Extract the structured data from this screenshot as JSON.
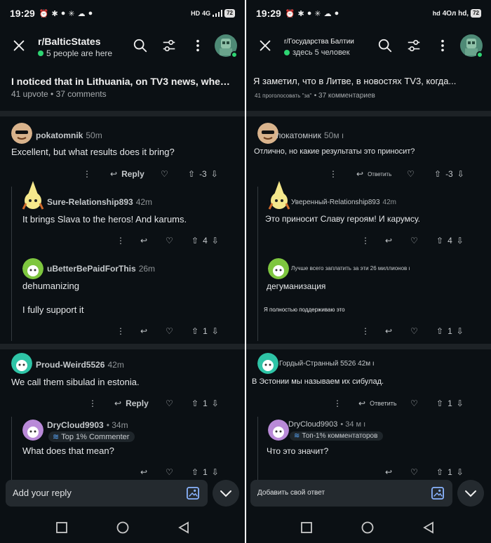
{
  "left": {
    "status": {
      "time": "19:29",
      "network": "HD",
      "network_type": "4G",
      "battery": "72"
    },
    "header": {
      "subreddit": "r/BalticStates",
      "online": "5 people are here"
    },
    "post": {
      "title": "I noticed that in Lithuania, on TV3 news, when the...",
      "meta": "41 upvote • 37 comments"
    },
    "comments": [
      {
        "author": "pokatomnik",
        "time": "50m",
        "body": "Excellent, but what results does it bring?",
        "reply_label": "Reply",
        "score": "-3"
      },
      {
        "author": "Sure-Relationship893",
        "time": "42m",
        "body": "It brings Slava to the heros! And karums.",
        "score": "4"
      },
      {
        "author": "uBetterBePaidForThis",
        "time": "26m",
        "body": "dehumanizing",
        "body2": "I fully support it",
        "score": "1"
      },
      {
        "author": "Proud-Weird5526",
        "time": "42m",
        "body": "We call them sibulad in estonia.",
        "reply_label": "Reply",
        "score": "1"
      },
      {
        "author": "DryCloud9903",
        "time": "• 34m",
        "badge": "Top 1% Commenter",
        "body": "What does that mean?",
        "score": "1"
      }
    ],
    "reply_placeholder": "Add your reply"
  },
  "right": {
    "status": {
      "time": "19:29",
      "network": "hd",
      "network_type": "4Ол hd,",
      "battery": "72"
    },
    "header": {
      "subreddit": "r/Государства Балтии",
      "online": "здесь 5 человек"
    },
    "post": {
      "title": "Я заметил, что в Литве, в новостях TV3, когда...",
      "meta_votes": "41 проголосовать \"за\"",
      "meta_comments": "• 37 комментариев"
    },
    "comments": [
      {
        "author": "покатомник",
        "time": "50м ı",
        "body": "Отлично, но какие результаты это приносит?",
        "reply_label": "Ответить",
        "score": "-3"
      },
      {
        "author": "Уверенный-Relationship893",
        "time": "42m",
        "body": "Это приносит Славу героям! И карумсу.",
        "score": "4"
      },
      {
        "author": "Лучше всего заплатить за эти 26 миллионов ı",
        "time": "",
        "body": "дегуманизация",
        "body2": "Я полностью поддерживаю это",
        "score": "1"
      },
      {
        "author": "Гордый-Странный 5526",
        "time": "42м ı",
        "body": "В Эстонии мы называем их сибулад.",
        "reply_label": "Ответить",
        "score": "1"
      },
      {
        "author": "DryCloud9903",
        "time": "• 34 м ı",
        "badge": "Топ-1% комментаторов",
        "body": "Что это значит?",
        "score": "1"
      }
    ],
    "reply_placeholder": "Добавить свой ответ"
  },
  "colors": {
    "background": "#0b1014",
    "online_green": "#2ed573",
    "separator": "#1d2226",
    "input_bg": "#242a2f"
  }
}
